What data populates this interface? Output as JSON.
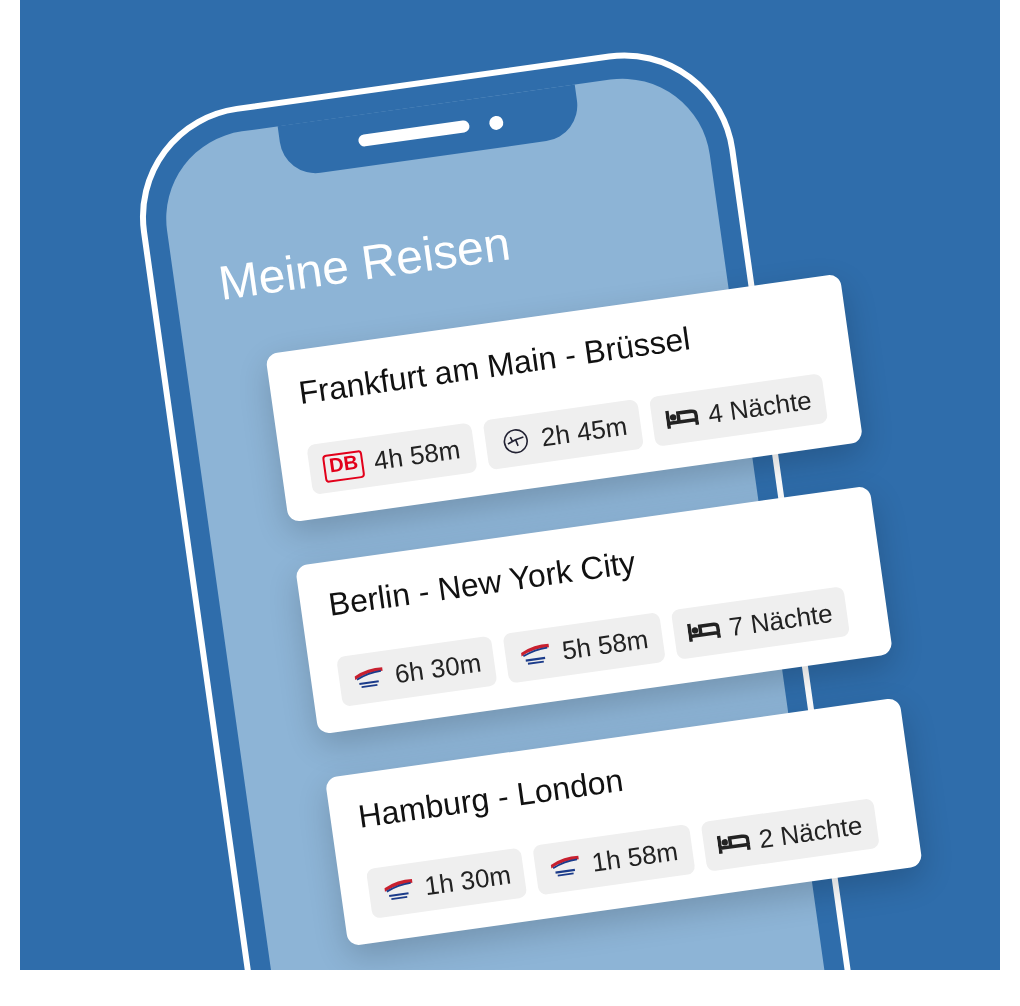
{
  "screen_title": "Meine Reisen",
  "trips": [
    {
      "title": "Frankfurt am Main - Brüssel",
      "segments": [
        {
          "kind": "rail",
          "logo": "DB",
          "duration": "4h 58m"
        },
        {
          "kind": "flight",
          "duration": "2h 45m"
        },
        {
          "kind": "hotel",
          "duration": "4 Nächte"
        }
      ]
    },
    {
      "title": "Berlin - New York City",
      "segments": [
        {
          "kind": "airline",
          "duration": "6h 30m"
        },
        {
          "kind": "airline",
          "duration": "5h 58m"
        },
        {
          "kind": "hotel",
          "duration": "7 Nächte"
        }
      ]
    },
    {
      "title": "Hamburg - London",
      "segments": [
        {
          "kind": "airline",
          "duration": "1h 30m"
        },
        {
          "kind": "airline",
          "duration": "1h 58m"
        },
        {
          "kind": "hotel",
          "duration": "2 Nächte"
        }
      ]
    }
  ]
}
